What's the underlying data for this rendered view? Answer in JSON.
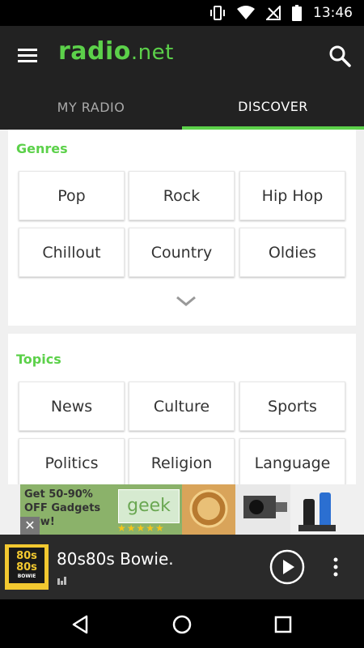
{
  "status_bar": {
    "time": "13:46",
    "icons": [
      "vibrate-icon",
      "wifi-icon",
      "no-signal-icon",
      "battery-icon"
    ]
  },
  "app_bar": {
    "logo_main": "radio",
    "logo_suffix": ".net",
    "menu_icon": "hamburger-menu-icon",
    "search_icon": "search-icon"
  },
  "tabs": [
    {
      "label": "MY RADIO",
      "active": false
    },
    {
      "label": "DISCOVER",
      "active": true
    }
  ],
  "genres": {
    "title": "Genres",
    "items": [
      "Pop",
      "Rock",
      "Hip Hop",
      "Chillout",
      "Country",
      "Oldies"
    ],
    "expand_icon": "chevron-down-icon"
  },
  "topics": {
    "title": "Topics",
    "items": [
      "News",
      "Culture",
      "Sports",
      "Politics",
      "Religion",
      "Language"
    ]
  },
  "ad": {
    "text": "Get 50-90% OFF Gadgets Now!",
    "brand": "geek",
    "rating_stars": 5
  },
  "player": {
    "station_name": "80s80s Bowie.",
    "art_text_1": "80s",
    "art_text_2": "80s",
    "art_text_3": "BOWIE",
    "play_icon": "play-circle-icon",
    "more_icon": "more-vert-icon"
  },
  "colors": {
    "accent": "#5cd14a",
    "appbar_bg": "#222222",
    "background": "#f0f0f0",
    "player_bg": "#2a2a2a"
  }
}
